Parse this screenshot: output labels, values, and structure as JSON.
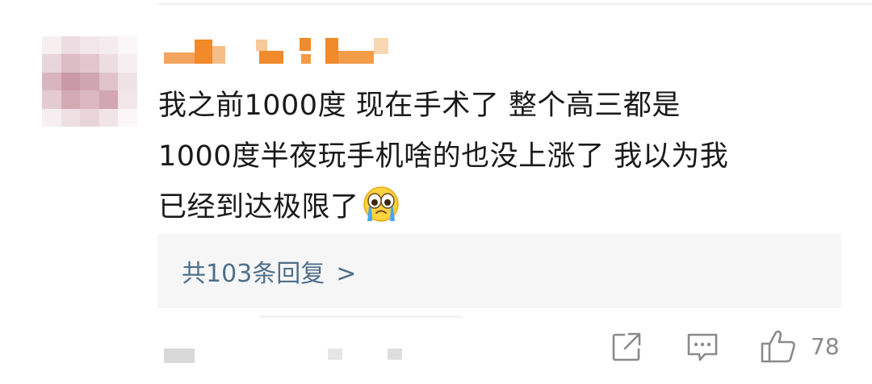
{
  "comment": {
    "lines": [
      "我之前1000度 现在手术了 整个高三都是",
      "1000度半夜玩手机啥的也没上涨了 我以为我",
      "已经到达极限了"
    ],
    "emoji": "crying-face-emoji"
  },
  "replies": {
    "label": "共103条回复",
    "chevron": ">"
  },
  "actions": {
    "share_icon": "share-icon",
    "comment_icon": "comment-icon",
    "like_icon": "thumbs-up-icon",
    "like_count": "78"
  },
  "colors": {
    "text": "#1a1a1a",
    "reply_link": "#4e6f8a",
    "reply_bg": "#f6f6f7",
    "icon": "#8a8a8a",
    "username_orange": "#f08a2a"
  }
}
